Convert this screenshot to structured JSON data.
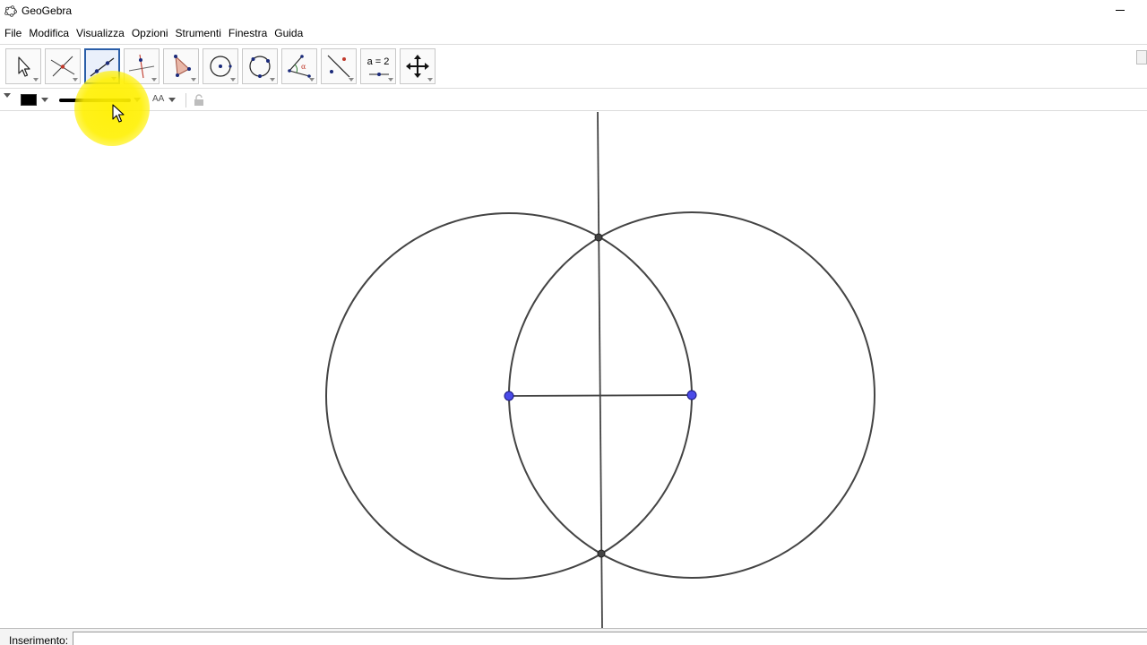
{
  "window": {
    "title": "GeoGebra"
  },
  "menu": {
    "items": [
      "File",
      "Modifica",
      "Visualizza",
      "Opzioni",
      "Strumenti",
      "Finestra",
      "Guida"
    ]
  },
  "toolbar": {
    "tools": [
      {
        "name": "move-tool-icon",
        "active": false
      },
      {
        "name": "point-tool-icon",
        "active": false
      },
      {
        "name": "line-tool-icon",
        "active": true
      },
      {
        "name": "perpendicular-line-tool-icon",
        "active": false
      },
      {
        "name": "polygon-tool-icon",
        "active": false
      },
      {
        "name": "circle-center-point-tool-icon",
        "active": false
      },
      {
        "name": "circle-three-points-tool-icon",
        "active": false
      },
      {
        "name": "angle-tool-icon",
        "active": false
      },
      {
        "name": "reflect-tool-icon",
        "active": false
      },
      {
        "name": "slider-tool-icon",
        "active": false,
        "label": "a = 2"
      },
      {
        "name": "move-graphics-view-tool-icon",
        "active": false
      }
    ]
  },
  "stylebar": {
    "color": "#000000",
    "font_size_glyph": "AA"
  },
  "input_bar": {
    "label": "Inserimento:",
    "value": ""
  },
  "colors": {
    "accent": "#2a5ea8",
    "free_point": "#4a4ae8",
    "construction": "#444444",
    "cursor_highlight": "#fff000"
  }
}
